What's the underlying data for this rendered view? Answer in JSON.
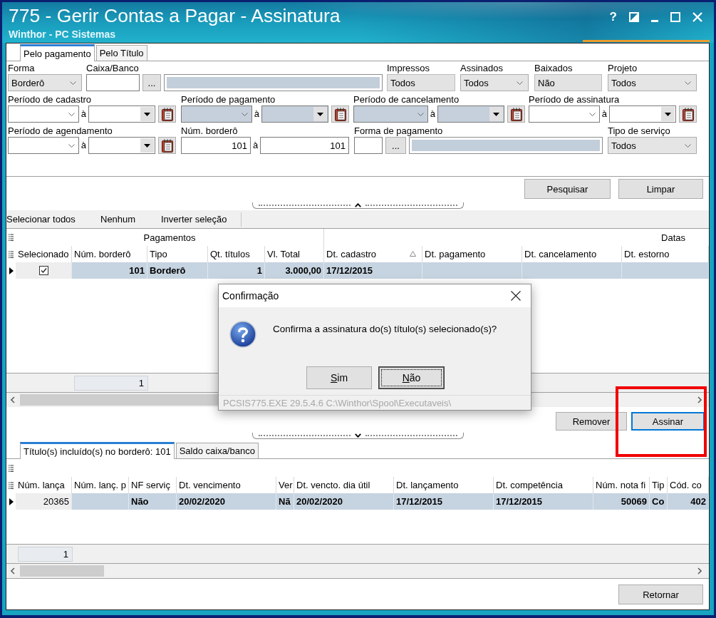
{
  "window": {
    "title": "775 - Gerir Contas a Pagar - Assinatura",
    "subtitle": "Winthor - PC Sistemas",
    "help": "?"
  },
  "tabs": [
    {
      "label": "Pelo pagamento",
      "selected": true
    },
    {
      "label": "Pelo Título",
      "selected": false
    }
  ],
  "filters": [
    [
      {
        "kind": "select",
        "label": "Forma",
        "value": "Borderô"
      },
      {
        "kind": "lookup",
        "label": "Caixa/Banco",
        "button": "..."
      },
      {
        "kind": "readonly",
        "label": "Impressos",
        "value": "Todos"
      },
      {
        "kind": "select",
        "label": "Assinados",
        "value": "Todos"
      },
      {
        "kind": "readonly",
        "label": "Baixados",
        "value": "Não"
      },
      {
        "kind": "select",
        "label": "Projeto",
        "value": "Todos"
      }
    ],
    [
      {
        "kind": "date_range",
        "label": "Período de cadastro",
        "separator": "à",
        "disabled": false
      },
      {
        "kind": "date_range",
        "label": "Período de pagamento",
        "separator": "à",
        "disabled": true
      },
      {
        "kind": "date_range",
        "label": "Período de cancelamento",
        "separator": "à",
        "disabled": true
      },
      {
        "kind": "date_range",
        "label": "Período de assinatura",
        "separator": "à",
        "disabled": false
      }
    ],
    [
      {
        "kind": "date_range",
        "label": "Período de agendamento",
        "separator": "à",
        "disabled": false
      },
      {
        "kind": "number_range",
        "label": "Núm. borderô",
        "from": "101",
        "separator": "à",
        "to": "101"
      },
      {
        "kind": "lookup",
        "label": "Forma de pagamento",
        "button": "..."
      },
      {
        "kind": "select",
        "label": "Tipo de serviço",
        "value": "Todos"
      }
    ]
  ],
  "search_buttons": [
    "Pesquisar",
    "Limpar"
  ],
  "selection_toolbar": [
    "Selecionar todos",
    "Nenhum",
    "Inverter seleção"
  ],
  "payments_grid": {
    "bands": [
      "Pagamentos",
      "Datas"
    ],
    "columns": [
      {
        "label": "Selecionado",
        "kind": "check",
        "sorted": false
      },
      {
        "label": "Núm. borderô",
        "kind": "number",
        "sorted": false
      },
      {
        "label": "Tipo",
        "kind": "text",
        "sorted": false
      },
      {
        "label": "Qt. títulos",
        "kind": "number",
        "sorted": false
      },
      {
        "label": "Vl. Total",
        "kind": "number",
        "sorted": false
      },
      {
        "label": "Dt. cadastro",
        "kind": "text",
        "sorted": true
      },
      {
        "label": "Dt. pagamento",
        "kind": "text",
        "sorted": false
      },
      {
        "label": "Dt. cancelamento",
        "kind": "text",
        "sorted": false
      },
      {
        "label": "Dt. estorno",
        "kind": "text",
        "sorted": false
      }
    ],
    "rows": [
      {
        "selected": true,
        "cells": [
          {
            "checked": true,
            "focused": true
          },
          {
            "text": "101",
            "focused": false
          },
          {
            "text": "Borderô",
            "focused": false
          },
          {
            "text": "1",
            "focused": false
          },
          {
            "text": "3.000,00",
            "focused": false
          },
          {
            "text": "17/12/2015",
            "focused": false
          },
          {
            "focused": false
          },
          {
            "focused": false
          },
          {
            "focused": false
          }
        ]
      }
    ],
    "footer_count": "1"
  },
  "actions": [
    {
      "label": "Remover",
      "focused": false,
      "highlighted": false
    },
    {
      "label": "Assinar",
      "focused": true,
      "highlighted": true
    }
  ],
  "detail_tabs": [
    {
      "label": "Título(s) incluído(s) no borderô: 101",
      "selected": true
    },
    {
      "label": "Saldo caixa/banco",
      "selected": false
    }
  ],
  "titles_grid": {
    "columns": [
      {
        "label": "Núm. lança",
        "kind": "number"
      },
      {
        "label": "Núm. lanç. p",
        "kind": "number"
      },
      {
        "label": "NF serviç",
        "kind": "text"
      },
      {
        "label": "Dt. vencimento",
        "kind": "text"
      },
      {
        "label": "Ver",
        "kind": "text"
      },
      {
        "label": "Dt. vencto. dia útil",
        "kind": "text"
      },
      {
        "label": "Dt. lançamento",
        "kind": "text"
      },
      {
        "label": "Dt. competência",
        "kind": "text"
      },
      {
        "label": "Núm. nota fi",
        "kind": "number"
      },
      {
        "label": "Tip",
        "kind": "text"
      },
      {
        "label": "Cód. co",
        "kind": "number"
      }
    ],
    "rows": [
      {
        "selected": true,
        "cells": [
          {
            "text": "20365",
            "focused": true
          },
          {
            "focused": false
          },
          {
            "text": "Não",
            "focused": false
          },
          {
            "text": "20/02/2020",
            "focused": false
          },
          {
            "text": "Nã",
            "focused": false
          },
          {
            "text": "20/02/2020",
            "focused": false
          },
          {
            "text": "17/12/2015",
            "focused": false
          },
          {
            "text": "17/12/2015",
            "focused": false
          },
          {
            "text": "50069",
            "focused": false
          },
          {
            "text": "Co",
            "focused": false
          },
          {
            "text": "402",
            "focused": false
          }
        ]
      }
    ],
    "footer_count": "1"
  },
  "bottom_buttons": [
    "Retornar"
  ],
  "dialog": {
    "title": "Confirmação",
    "message": "Confirma a assinatura do(s) título(s) selecionado(s)?",
    "buttons": [
      {
        "label": "Sim",
        "focused": false
      },
      {
        "label": "Não",
        "focused": true
      }
    ],
    "status": "PCSIS775.EXE 29.5.4.6 C:\\Winthor\\Spool\\Executaveis\\"
  }
}
